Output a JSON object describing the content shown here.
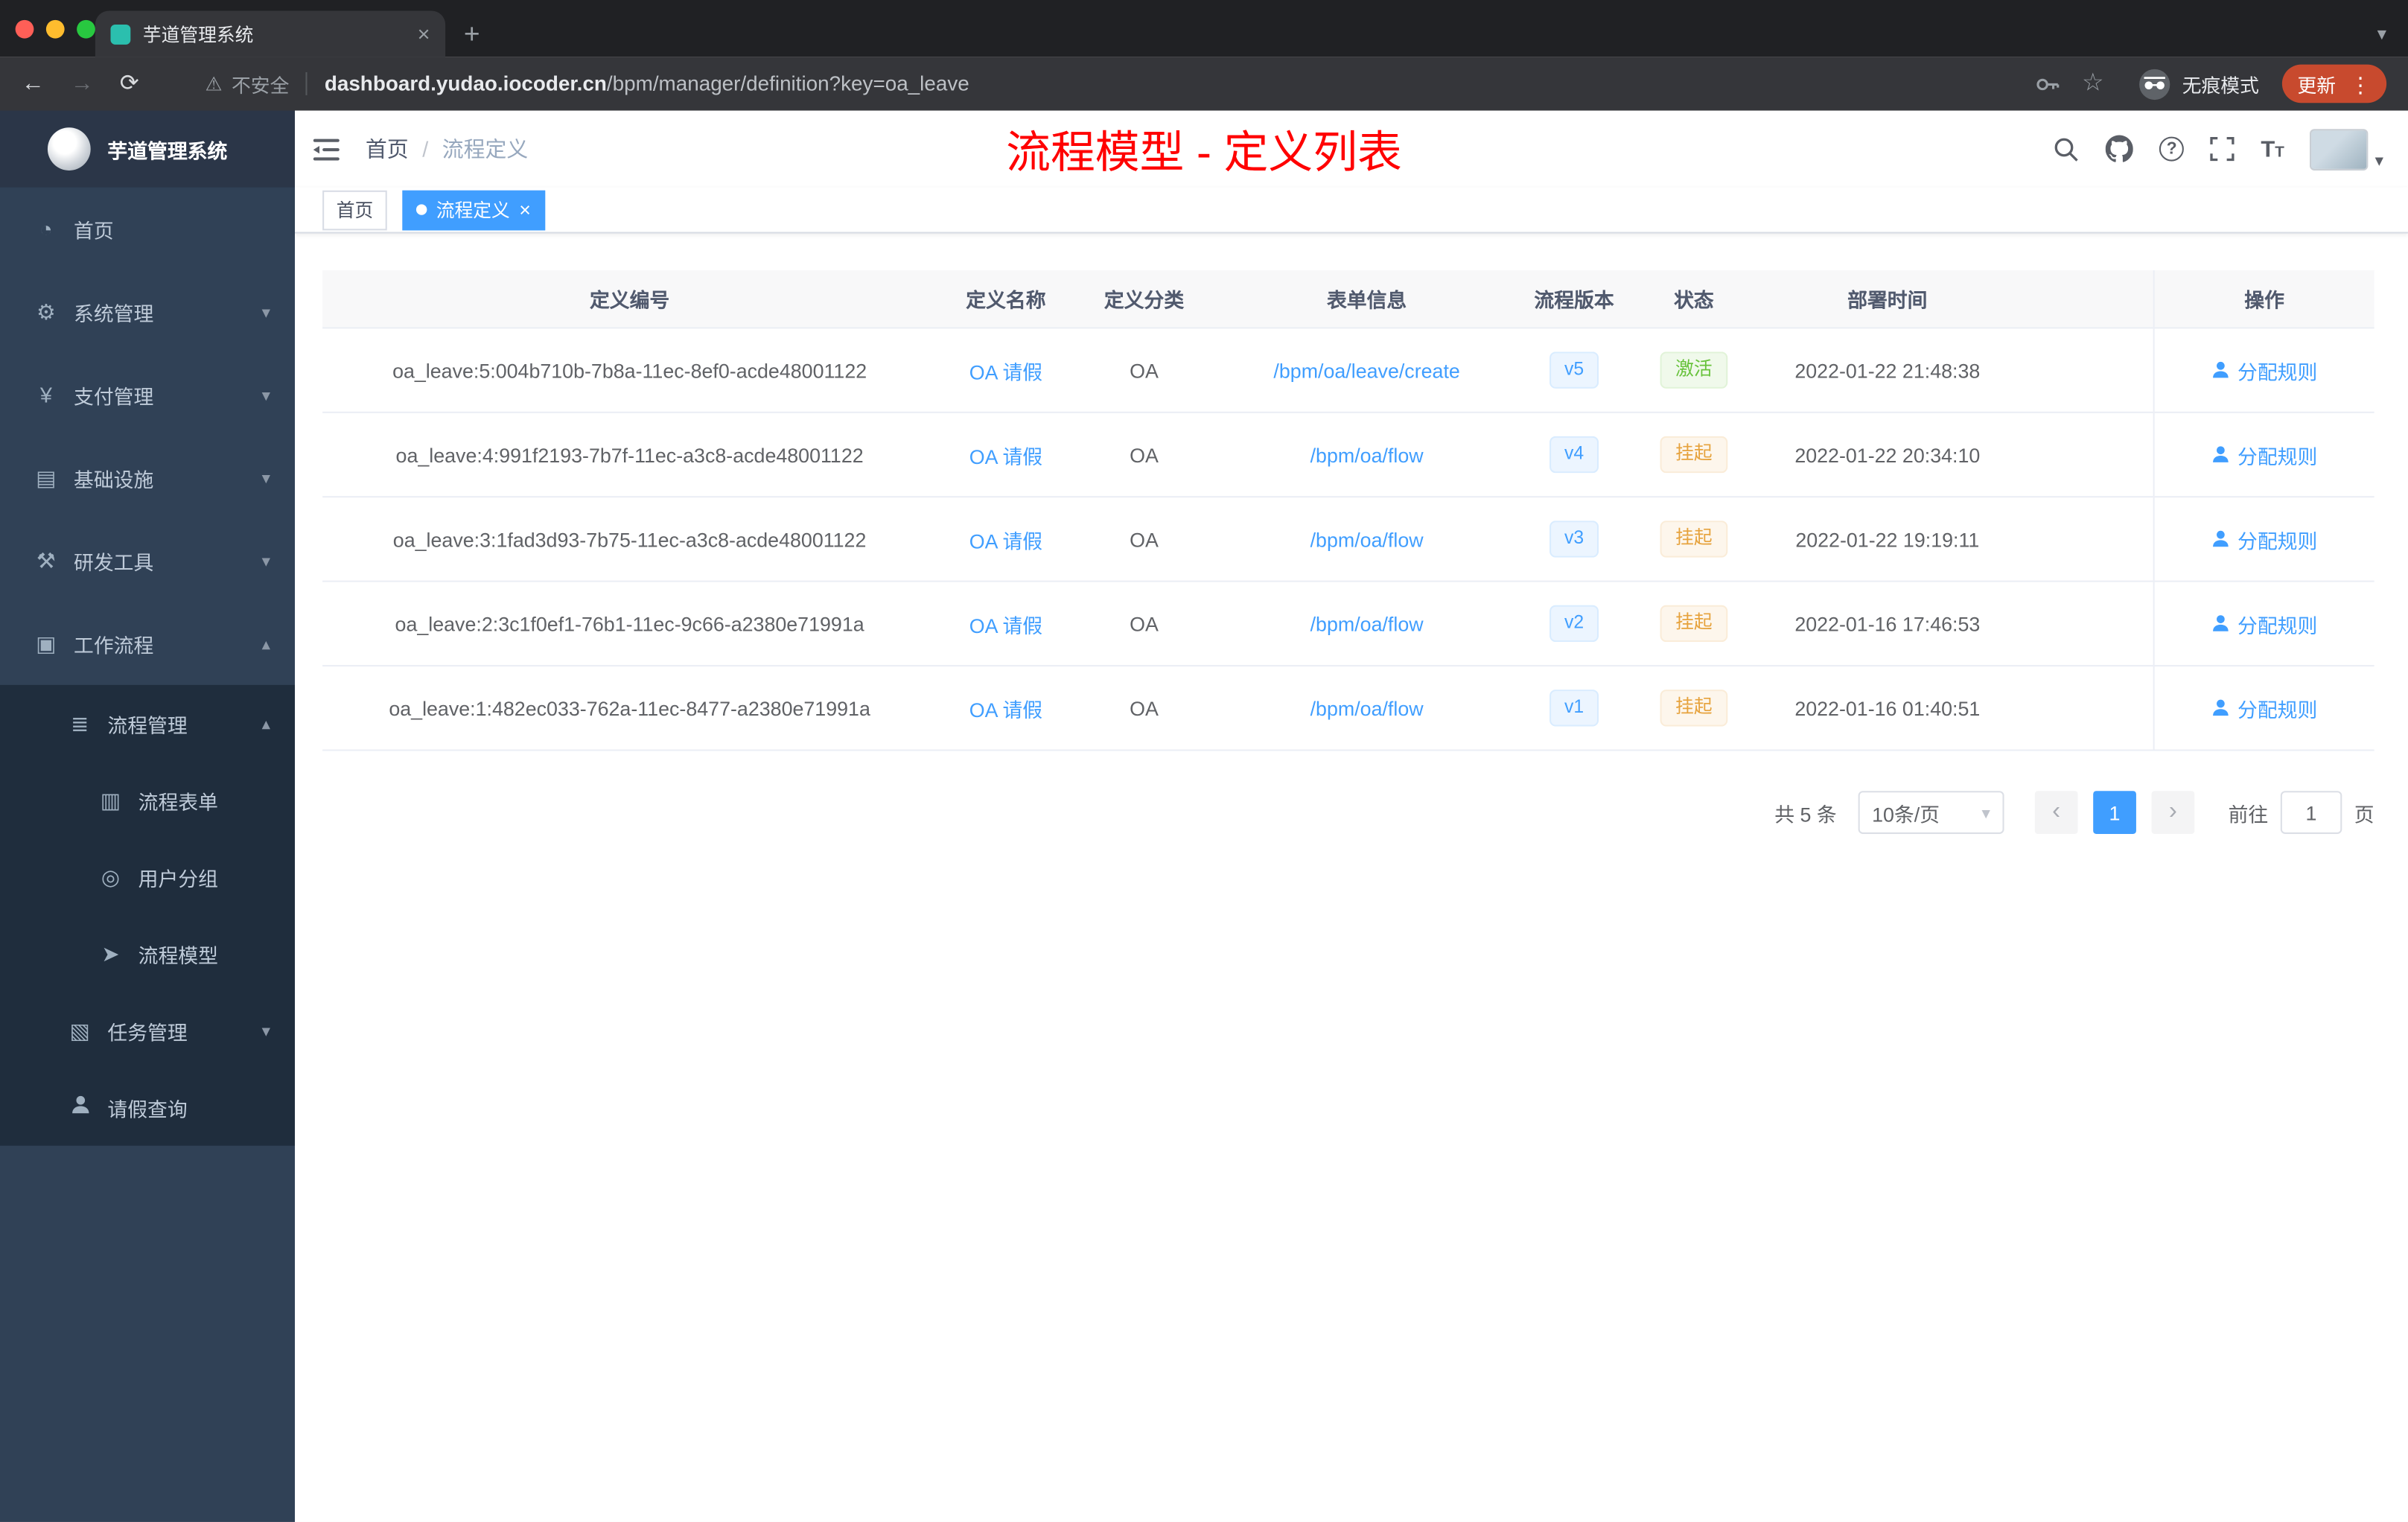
{
  "browser": {
    "tab_title": "芋道管理系统",
    "security_label": "不安全",
    "url_domain": "dashboard.yudao.iocoder.cn",
    "url_path": "/bpm/manager/definition?key=oa_leave",
    "incognito_label": "无痕模式",
    "update_label": "更新"
  },
  "sidebar": {
    "logo_title": "芋道管理系统",
    "home": "首页",
    "system": "系统管理",
    "payment": "支付管理",
    "infrastructure": "基础设施",
    "devtools": "研发工具",
    "workflow": "工作流程",
    "process_mgmt": "流程管理",
    "process_form": "流程表单",
    "user_group": "用户分组",
    "process_model": "流程模型",
    "task_mgmt": "任务管理",
    "leave_query": "请假查询"
  },
  "header": {
    "breadcrumb_home": "首页",
    "breadcrumb_sep": "/",
    "breadcrumb_current": "流程定义",
    "annotation": "流程模型 - 定义列表"
  },
  "tags": {
    "home": "首页",
    "active": "流程定义"
  },
  "table": {
    "columns": [
      "定义编号",
      "定义名称",
      "定义分类",
      "表单信息",
      "流程版本",
      "状态",
      "部署时间",
      "操作"
    ],
    "rows": [
      {
        "id": "oa_leave:5:004b710b-7b8a-11ec-8ef0-acde48001122",
        "name": "OA 请假",
        "category": "OA",
        "form": "/bpm/oa/leave/create",
        "version": "v5",
        "status": "激活",
        "time": "2022-01-22 21:48:38",
        "action": "分配规则"
      },
      {
        "id": "oa_leave:4:991f2193-7b7f-11ec-a3c8-acde48001122",
        "name": "OA 请假",
        "category": "OA",
        "form": "/bpm/oa/flow",
        "version": "v4",
        "status": "挂起",
        "time": "2022-01-22 20:34:10",
        "action": "分配规则"
      },
      {
        "id": "oa_leave:3:1fad3d93-7b75-11ec-a3c8-acde48001122",
        "name": "OA 请假",
        "category": "OA",
        "form": "/bpm/oa/flow",
        "version": "v3",
        "status": "挂起",
        "time": "2022-01-22 19:19:11",
        "action": "分配规则"
      },
      {
        "id": "oa_leave:2:3c1f0ef1-76b1-11ec-9c66-a2380e71991a",
        "name": "OA 请假",
        "category": "OA",
        "form": "/bpm/oa/flow",
        "version": "v2",
        "status": "挂起",
        "time": "2022-01-16 17:46:53",
        "action": "分配规则"
      },
      {
        "id": "oa_leave:1:482ec033-762a-11ec-8477-a2380e71991a",
        "name": "OA 请假",
        "category": "OA",
        "form": "/bpm/oa/flow",
        "version": "v1",
        "status": "挂起",
        "time": "2022-01-16 01:40:51",
        "action": "分配规则"
      }
    ]
  },
  "pagination": {
    "total": "共 5 条",
    "page_size": "10条/页",
    "current_page": "1",
    "goto_label": "前往",
    "goto_value": "1",
    "goto_unit": "页"
  },
  "colors": {
    "accent": "#409eff",
    "success": "#67c23a",
    "warning": "#e6a23c",
    "annotation_red": "#ff0000",
    "sidebar_bg": "#304156",
    "submenu_bg": "#1f2d3d"
  },
  "icons": {
    "close": "×",
    "plus": "+",
    "caret_down": "▾",
    "caret_up": "▴",
    "back": "←",
    "forward": "→",
    "reload": "⟳",
    "warning": "⚠",
    "star": "☆",
    "dots": "⋮",
    "dashboard": "◔",
    "gear": "⚙",
    "yen": "¥",
    "infrastructure": "▤",
    "tools": "⚒",
    "workflow": "▣",
    "list": "≣",
    "form": "▥",
    "group": "◎",
    "model": "➤",
    "task": "▧",
    "prev": "‹",
    "next": "›",
    "question": "?"
  }
}
